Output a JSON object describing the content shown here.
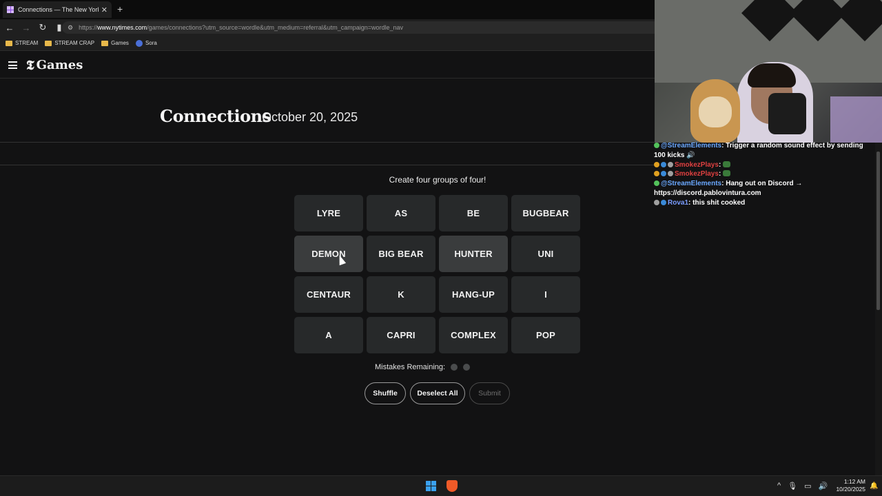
{
  "browser": {
    "tab_title": "Connections — The New York Ti",
    "tab_close": "✕",
    "new_tab": "+",
    "url_prefix": "https://",
    "url_host": "www.nytimes.com",
    "url_path": "/games/connections?utm_source=wordle&utm_medium=referral&utm_campaign=wordle_nav",
    "nav_back": "←",
    "nav_forward": "→",
    "nav_reload": "↻",
    "bookmark_icon": "bookmark-icon",
    "bookmarks": [
      {
        "label": "STREAM",
        "icon": "folder-icon"
      },
      {
        "label": "STREAM CRAP",
        "icon": "folder-icon"
      },
      {
        "label": "Games",
        "icon": "folder-icon"
      },
      {
        "label": "Sora",
        "icon": "sora-icon"
      }
    ]
  },
  "header": {
    "logo_t": "𝕿",
    "logo_text": "Games"
  },
  "game": {
    "title": "Connections",
    "date": "October 20, 2025",
    "instruction": "Create four groups of four!",
    "tiles": [
      "LYRE",
      "AS",
      "BE",
      "BUGBEAR",
      "DEMON",
      "BIG BEAR",
      "HUNTER",
      "UNI",
      "CENTAUR",
      "K",
      "HANG-UP",
      "I",
      "A",
      "CAPRI",
      "COMPLEX",
      "POP"
    ],
    "selected_tiles": [
      "DEMON",
      "HUNTER"
    ],
    "mistakes_label": "Mistakes Remaining:",
    "mistakes_remaining": 2,
    "buttons": {
      "shuffle": "Shuffle",
      "deselect": "Deselect All",
      "submit": "Submit"
    }
  },
  "chat": {
    "messages": [
      {
        "user": "@StreamElements",
        "sep": ": ",
        "text": "Trigger a random sound effect by sending 100 kicks 🔊"
      },
      {
        "user": "SmokezPlays",
        "sep": ": ",
        "text": ""
      },
      {
        "user": "SmokezPlays",
        "sep": ": ",
        "text": ""
      },
      {
        "user": "@StreamElements",
        "sep": ": ",
        "text": "Hang out on Discord → https://discord.pablovintura.com"
      },
      {
        "user": "Rova1",
        "sep": ": ",
        "text": "this shit cooked"
      }
    ]
  },
  "taskbar": {
    "time": "1:12 AM",
    "date": "10/20/2025",
    "tray_chevron": "^"
  },
  "colors": {
    "page_bg": "#121213",
    "tile_bg": "#27292a",
    "tile_selected_bg": "#3a3c3d",
    "streamelements": "#6aa8ff",
    "smokez": "#e04040"
  }
}
